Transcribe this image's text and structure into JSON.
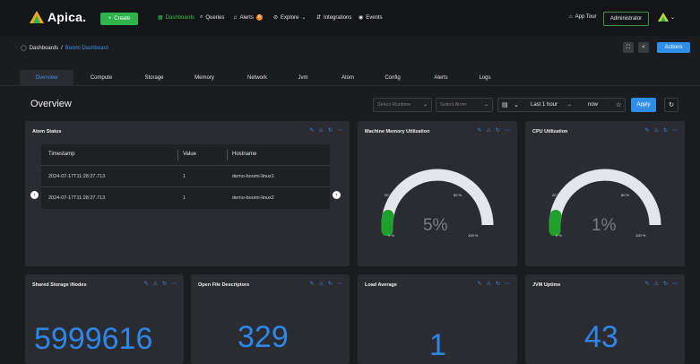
{
  "topbar": {
    "brand": "Apica.",
    "create_label": "Create",
    "nav": [
      {
        "label": "Dashboards"
      },
      {
        "label": "Queries"
      },
      {
        "label": "Alerts",
        "badge": "6"
      },
      {
        "label": "Explore"
      },
      {
        "label": "Integrations"
      },
      {
        "label": "Events"
      }
    ],
    "app_tour": "App Tour",
    "user": "Administrator"
  },
  "breadcrumb": {
    "root": "Dashboards",
    "separator": "/",
    "current": "Boomi Dashboard"
  },
  "actions_label": "Actions",
  "tabs": [
    "Overview",
    "Compute",
    "Storage",
    "Memory",
    "Network",
    "Jvm",
    "Atom",
    "Config",
    "Alerts",
    "Logs"
  ],
  "page_title": "Overview",
  "filters": {
    "runtime_placeholder": "Select Runtime",
    "atom_placeholder": "Select Atom",
    "time_from": "Last 1 hour",
    "time_arrow": "→",
    "time_to": "now",
    "apply_label": "Apply"
  },
  "atom_status": {
    "title": "Atom Status",
    "columns": [
      "Timestamp",
      "Value",
      "Hostname"
    ],
    "rows": [
      {
        "timestamp": "2024-07-17T11:28:27.713",
        "value": "1",
        "hostname": "demo-boomi-linux1"
      },
      {
        "timestamp": "2024-07-17T11:28:27.713",
        "value": "1",
        "hostname": "demo-boomi-linux2"
      }
    ]
  },
  "memory_gauge": {
    "title": "Machine Memory Utilization",
    "value": "5%",
    "fraction": 0.05,
    "ticks": [
      "0 %",
      "20 %",
      "40 %",
      "60 %",
      "80 %",
      "100 %"
    ]
  },
  "cpu_gauge": {
    "title": "CPU Utilization",
    "value": "1%",
    "fraction": 0.01,
    "ticks": [
      "0 %",
      "20 %",
      "40 %",
      "60 %",
      "80 %",
      "100 %"
    ]
  },
  "stats": [
    {
      "title": "Shared Storage iNodes",
      "value": "5999616"
    },
    {
      "title": "Open File Descriptors",
      "value": "329"
    },
    {
      "title": "Load Average",
      "value": "1"
    },
    {
      "title": "JVM Uptime",
      "value": "43"
    }
  ],
  "colors": {
    "accent": "#2f8fe8",
    "green": "#2fb34b",
    "gauge_track": "#e4e6ec",
    "gauge_fill": "#1fa02c"
  }
}
